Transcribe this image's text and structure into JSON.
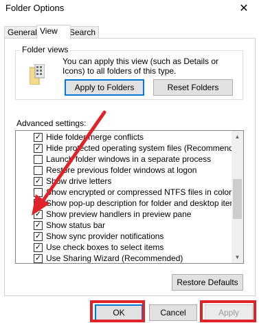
{
  "window": {
    "title": "Folder Options",
    "close_icon": "close-icon"
  },
  "tabs": [
    {
      "label": "General",
      "active": false
    },
    {
      "label": "View",
      "active": true
    },
    {
      "label": "Search",
      "active": false
    }
  ],
  "folder_views": {
    "label": "Folder views",
    "description": "You can apply this view (such as Details or Icons) to all folders of this type.",
    "apply_button": "Apply to Folders",
    "reset_button": "Reset Folders"
  },
  "advanced": {
    "label": "Advanced settings:",
    "items": [
      {
        "label": "Hide folder merge conflicts",
        "checked": true
      },
      {
        "label": "Hide protected operating system files (Recommended)",
        "checked": true
      },
      {
        "label": "Launch folder windows in a separate process",
        "checked": false
      },
      {
        "label": "Restore previous folder windows at logon",
        "checked": false
      },
      {
        "label": "Show drive letters",
        "checked": true
      },
      {
        "label": "Show encrypted or compressed NTFS files in color",
        "checked": false
      },
      {
        "label": "Show pop-up description for folder and desktop items",
        "checked": true
      },
      {
        "label": "Show preview handlers in preview pane",
        "checked": true
      },
      {
        "label": "Show status bar",
        "checked": true
      },
      {
        "label": "Show sync provider notifications",
        "checked": true
      },
      {
        "label": "Use check boxes to select items",
        "checked": true
      },
      {
        "label": "Use Sharing Wizard (Recommended)",
        "checked": true
      }
    ],
    "restore_button": "Restore Defaults"
  },
  "footer": {
    "ok": "OK",
    "cancel": "Cancel",
    "apply": "Apply"
  },
  "colors": {
    "highlight": "#e0222a",
    "focus": "#0078d7"
  }
}
